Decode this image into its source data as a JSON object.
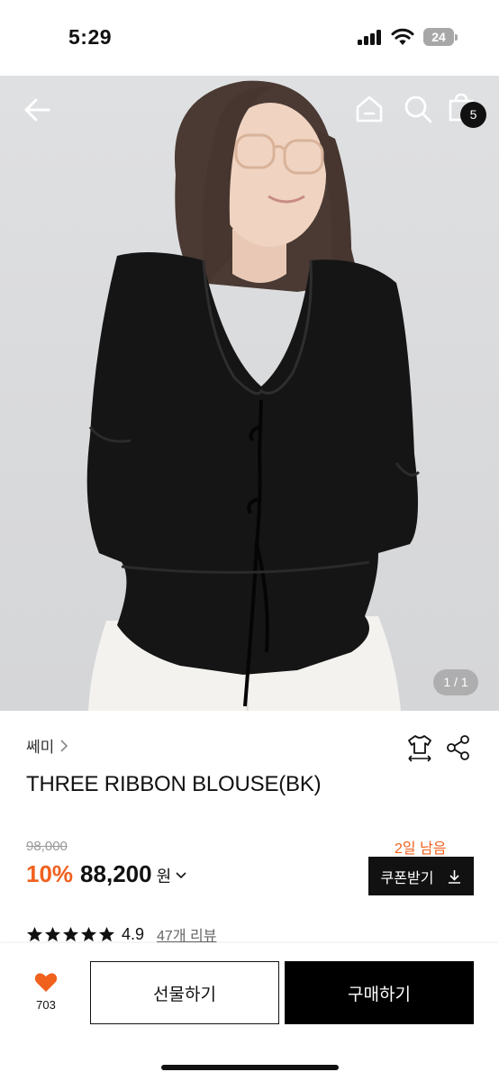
{
  "status_bar": {
    "time": "5:29",
    "battery_level": "24",
    "icons": [
      "cellular-signal-icon",
      "wifi-icon",
      "battery-icon"
    ]
  },
  "header": {
    "icons": [
      "back-arrow-icon",
      "home-icon",
      "search-icon",
      "shopping-bag-icon"
    ],
    "cart_count": "5"
  },
  "gallery": {
    "page_indicator": "1 / 1"
  },
  "product": {
    "brand": "쎄미",
    "title": "THREE RIBBON BLOUSE(BK)",
    "original_price": "98,000",
    "discount": "10%",
    "price": "88,200",
    "currency": "원",
    "days_left": "2일 남음",
    "coupon_label": "쿠폰받기",
    "rating": "4.9",
    "rating_stars": 5,
    "review_link": "47개 리뷰"
  },
  "actions": {
    "like_count": "703",
    "gift_label": "선물하기",
    "buy_label": "구매하기"
  },
  "colors": {
    "accent": "#f0611e",
    "primary": "#111111",
    "heart": "#f0611e"
  }
}
